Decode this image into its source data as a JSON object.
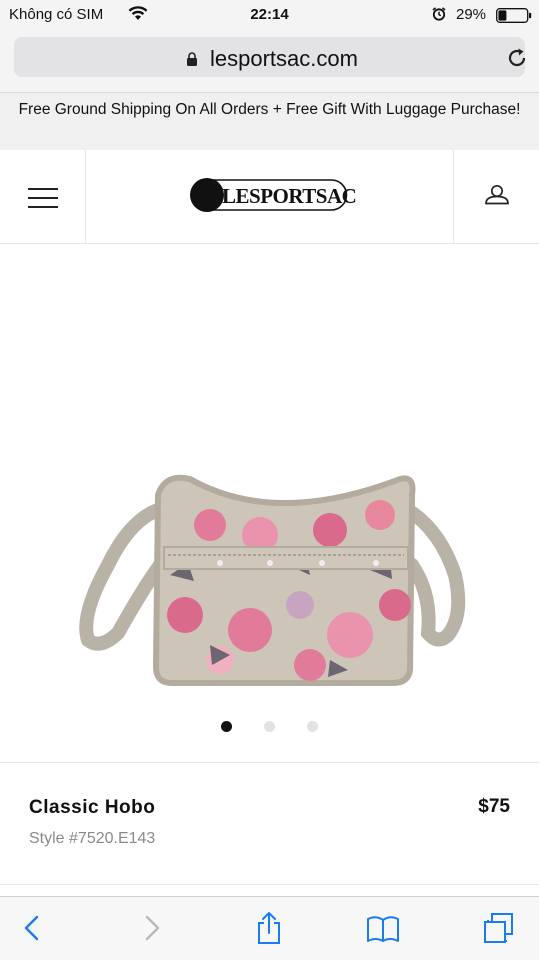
{
  "status_bar": {
    "carrier": "Không có SIM",
    "time": "22:14",
    "battery_percent": "29%",
    "battery_level": 0.29,
    "icons": [
      "wifi-icon",
      "alarm-icon",
      "battery-icon"
    ]
  },
  "browser": {
    "url": "lesportsac.com",
    "icons": [
      "lock-icon",
      "reload-icon"
    ]
  },
  "promo": {
    "text": "Free Ground Shipping On All Orders + Free Gift With Luggage Purchase!"
  },
  "header": {
    "logo_text": "LESPORTSAC",
    "icons": [
      "menu-icon",
      "account-icon"
    ]
  },
  "gallery": {
    "image_name": "classic-hobo-floral-bag",
    "slide_count": 3,
    "active_slide": 1
  },
  "product": {
    "name": "Classic Hobo",
    "price": "$75",
    "style": "Style #7520.E143"
  },
  "toolbar": {
    "icons": [
      "back-icon",
      "forward-icon",
      "share-icon",
      "bookmarks-icon",
      "tabs-icon"
    ]
  },
  "colors": {
    "accent": "#1a7cf2",
    "promo_bg": "#f0f0f0",
    "bag_base": "#cdc6b8",
    "rose": "#e27b9a"
  }
}
